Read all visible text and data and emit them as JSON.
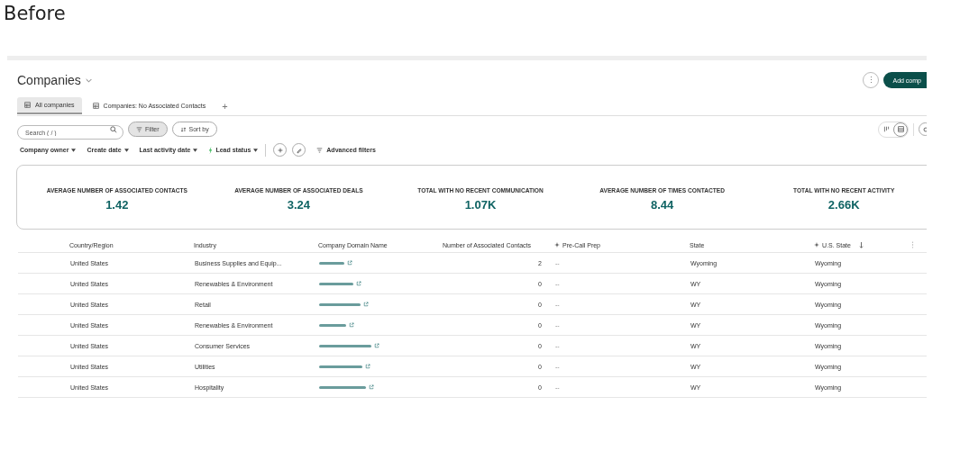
{
  "heading": "Before",
  "page": {
    "title": "Companies",
    "more_label": "⋮",
    "add_button": "Add comp"
  },
  "tabs": [
    {
      "label": "All companies",
      "selected": true
    },
    {
      "label": "Companies: No Associated Contacts",
      "selected": false
    }
  ],
  "add_tab": "+",
  "search": {
    "placeholder": "Search ( / )"
  },
  "filter_button": {
    "label": "Filter",
    "active": true
  },
  "sort_button": {
    "label": "Sort by"
  },
  "view_toggle": [
    {
      "kind": "board",
      "selected": false
    },
    {
      "kind": "table",
      "selected": true
    }
  ],
  "quick_filters": [
    {
      "label": "Company owner",
      "kind": "plain"
    },
    {
      "label": "Create date",
      "kind": "plain"
    },
    {
      "label": "Last activity date",
      "kind": "plain"
    },
    {
      "label": "Lead status",
      "kind": "ai"
    }
  ],
  "advanced_filters": "Advanced filters",
  "stats": [
    {
      "label": "AVERAGE NUMBER OF ASSOCIATED CONTACTS",
      "value": "1.42"
    },
    {
      "label": "AVERAGE NUMBER OF ASSOCIATED DEALS",
      "value": "3.24"
    },
    {
      "label": "TOTAL WITH NO RECENT COMMUNICATION",
      "value": "1.07K"
    },
    {
      "label": "AVERAGE NUMBER OF TIMES CONTACTED",
      "value": "8.44"
    },
    {
      "label": "TOTAL WITH NO RECENT ACTIVITY",
      "value": "2.66K"
    }
  ],
  "table": {
    "columns": [
      {
        "label": "Country/Region",
        "kind": "plain"
      },
      {
        "label": "Industry",
        "kind": "plain"
      },
      {
        "label": "Company Domain Name",
        "kind": "plain"
      },
      {
        "label": "Number of Associated Contacts",
        "kind": "plain"
      },
      {
        "label": "Pre-Call Prep",
        "kind": "ai"
      },
      {
        "label": "State",
        "kind": "plain"
      },
      {
        "label": "U.S. State",
        "kind": "ai-sorted"
      }
    ],
    "rows": [
      {
        "country": "United States",
        "industry": "Business Supplies and Equip...",
        "contacts": "2",
        "pre_call": "--",
        "state": "Wyoming",
        "us_state": "Wyoming"
      },
      {
        "country": "United States",
        "industry": "Renewables & Environment",
        "contacts": "0",
        "pre_call": "--",
        "state": "WY",
        "us_state": "Wyoming"
      },
      {
        "country": "United States",
        "industry": "Retail",
        "contacts": "0",
        "pre_call": "--",
        "state": "WY",
        "us_state": "Wyoming"
      },
      {
        "country": "United States",
        "industry": "Renewables & Environment",
        "contacts": "0",
        "pre_call": "--",
        "state": "WY",
        "us_state": "Wyoming"
      },
      {
        "country": "United States",
        "industry": "Consumer Services",
        "contacts": "0",
        "pre_call": "--",
        "state": "WY",
        "us_state": "Wyoming"
      },
      {
        "country": "United States",
        "industry": "Utilities",
        "contacts": "0",
        "pre_call": "--",
        "state": "WY",
        "us_state": "Wyoming"
      },
      {
        "country": "United States",
        "industry": "Hospitality",
        "contacts": "0",
        "pre_call": "--",
        "state": "WY",
        "us_state": "Wyoming"
      }
    ]
  }
}
